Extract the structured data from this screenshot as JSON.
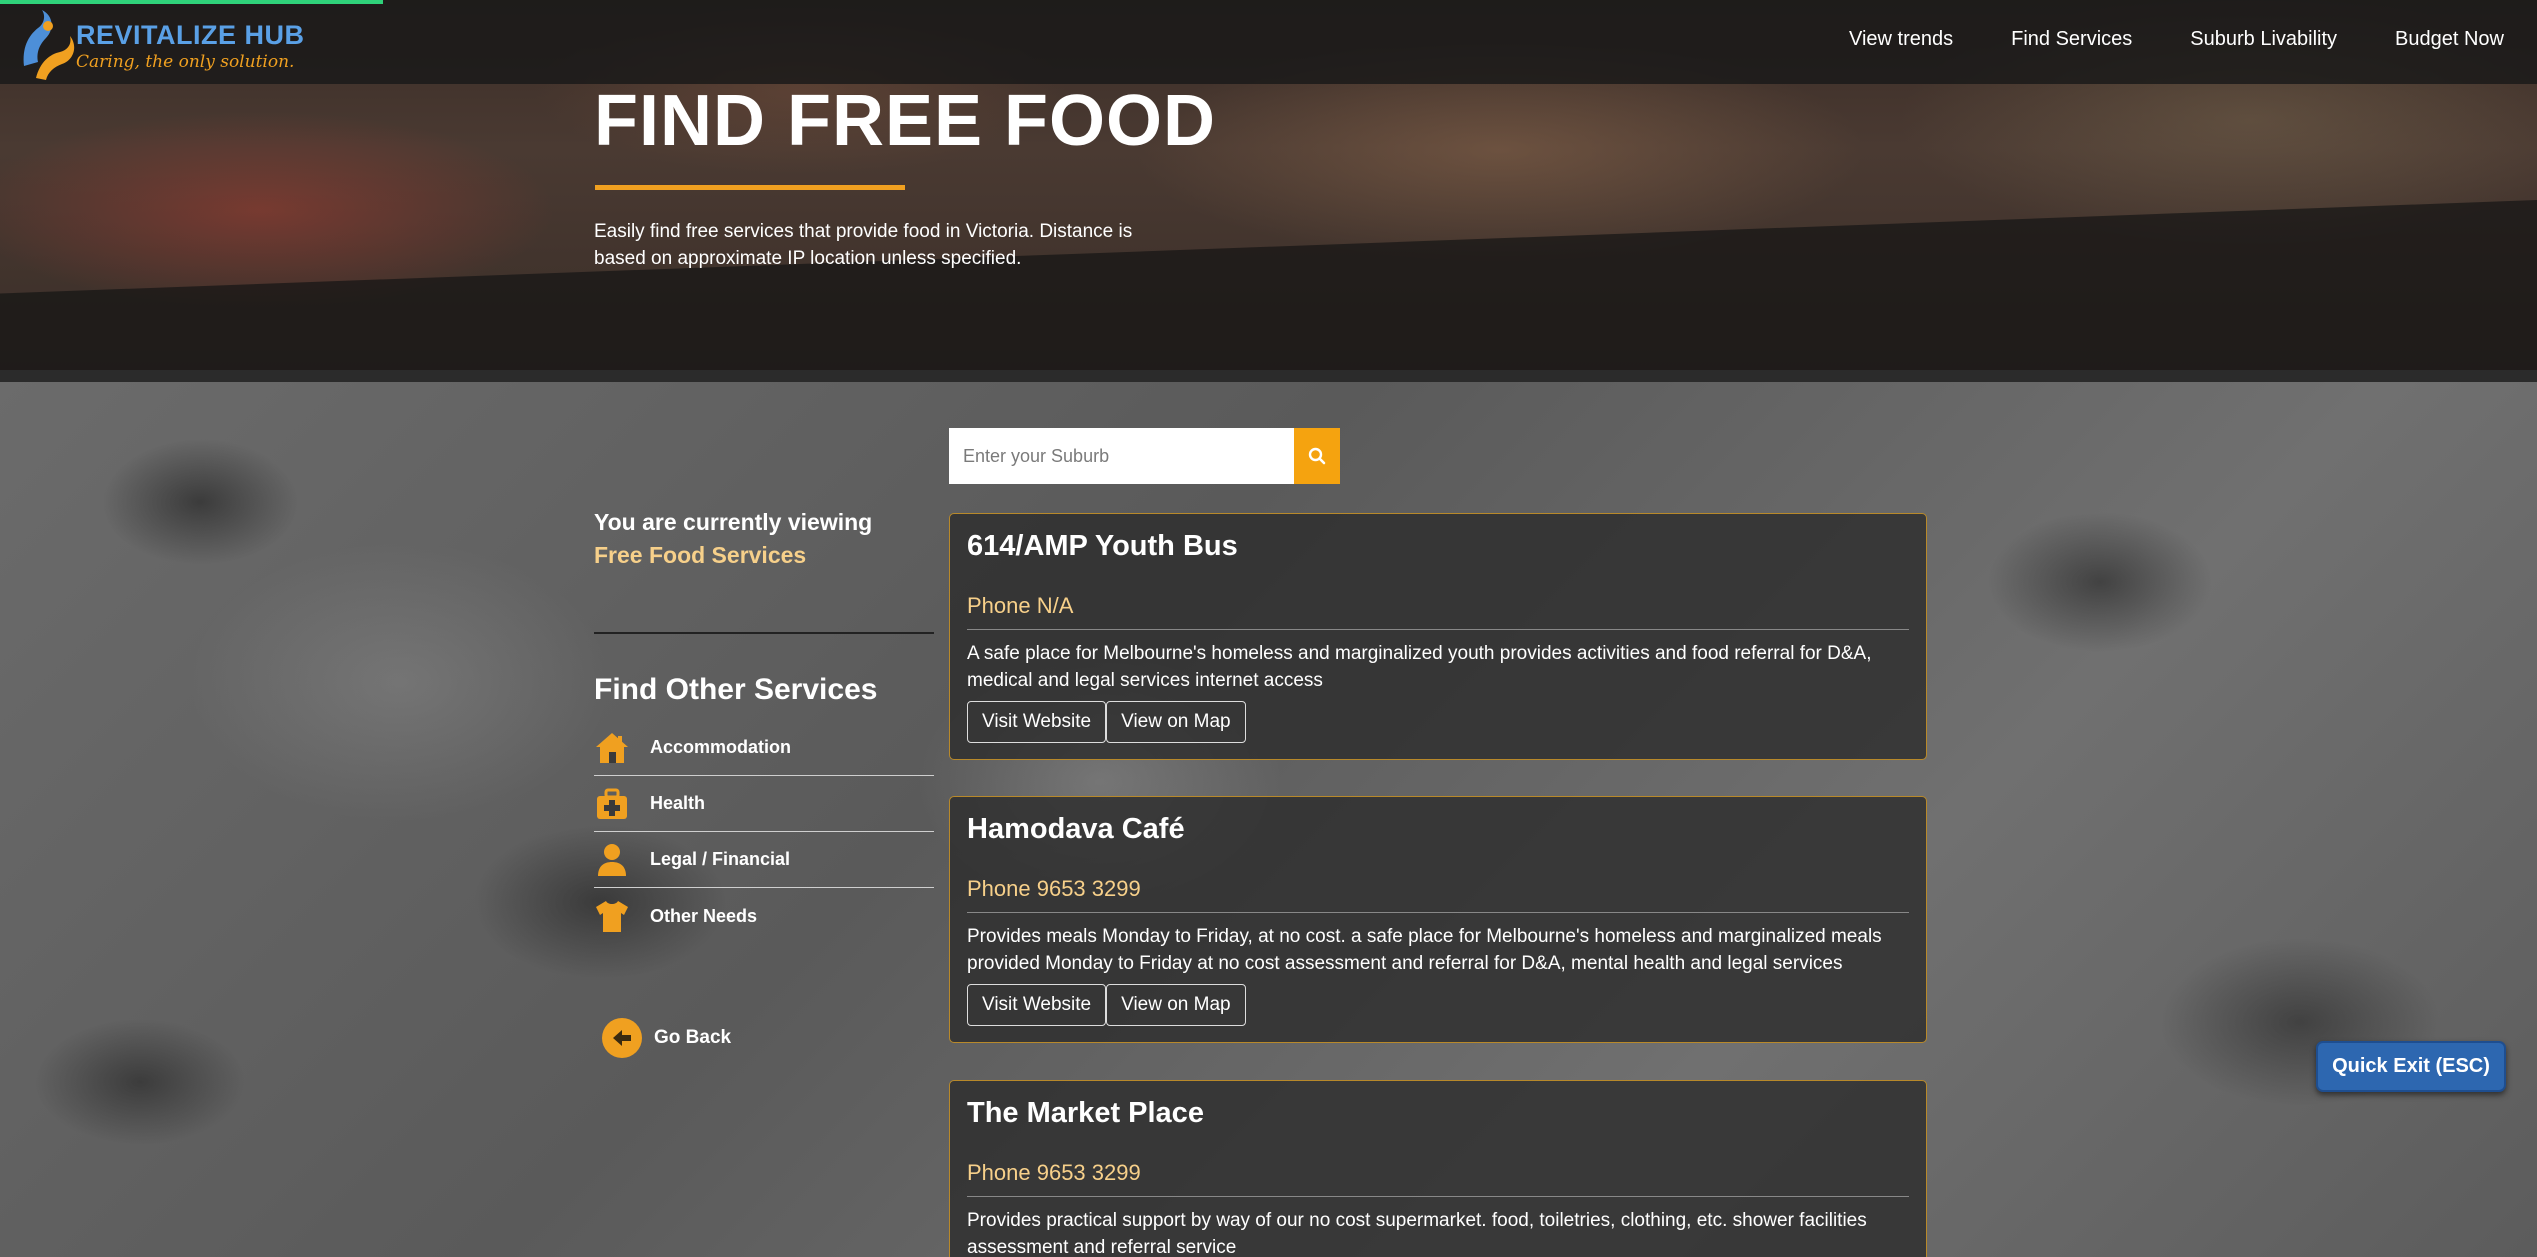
{
  "brand": {
    "name": "REVITALIZE HUB",
    "tagline": "Caring, the only solution."
  },
  "nav": {
    "items": [
      {
        "label": "View trends"
      },
      {
        "label": "Find Services"
      },
      {
        "label": "Suburb Livability"
      },
      {
        "label": "Budget Now"
      }
    ]
  },
  "hero": {
    "title": "FIND FREE FOOD",
    "intro": "Easily find free services that provide food in Victoria. Distance is based on approximate IP location unless specified."
  },
  "sidebar": {
    "viewing_prefix": "You are currently viewing",
    "viewing_value": "Free Food Services",
    "other_title": "Find Other Services",
    "services": [
      {
        "label": "Accommodation",
        "icon": "house-icon"
      },
      {
        "label": "Health",
        "icon": "first-aid-kit-icon"
      },
      {
        "label": "Legal / Financial",
        "icon": "person-icon"
      },
      {
        "label": "Other Needs",
        "icon": "shirt-icon"
      }
    ],
    "go_back": "Go Back"
  },
  "search": {
    "placeholder": "Enter your Suburb",
    "icon": "search-icon"
  },
  "results": [
    {
      "name": "614/AMP Youth Bus",
      "phone": "Phone N/A",
      "description": "A safe place for Melbourne's homeless and marginalized youth provides activities and food referral for D&A, medical and legal services internet access",
      "website_label": "Visit Website",
      "map_label": "View on Map"
    },
    {
      "name": "Hamodava Café",
      "phone": "Phone 9653 3299",
      "description": "Provides meals Monday to Friday, at no cost. a safe place for Melbourne's homeless and marginalized meals provided Monday to Friday at no cost assessment and referral for D&A, mental health and legal services",
      "website_label": "Visit Website",
      "map_label": "View on Map"
    },
    {
      "name": "The Market Place",
      "phone": "Phone 9653 3299",
      "description": "Provides practical support by way of our no cost supermarket. food, toiletries, clothing, etc. shower facilities assessment and referral service"
    }
  ],
  "quick_exit": "Quick Exit (ESC)",
  "colors": {
    "accent": "#f0a020",
    "brand_blue": "#5aa0e6",
    "quick_exit": "#2d67b0",
    "progress": "#2fd27a"
  }
}
